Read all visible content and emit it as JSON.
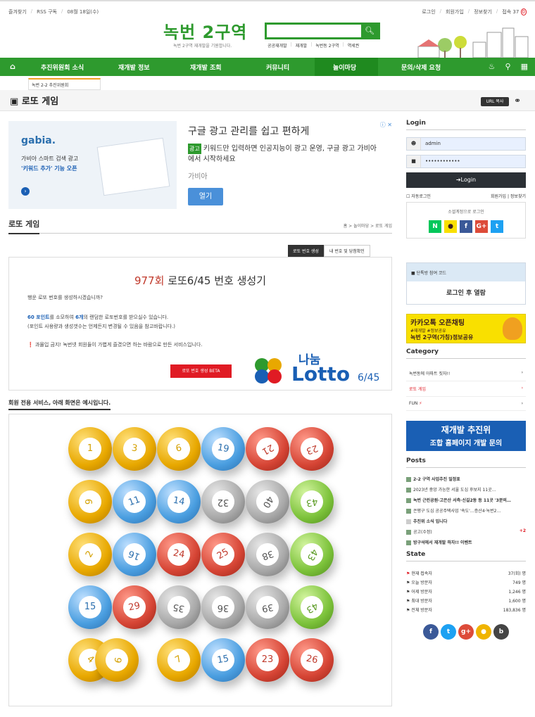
{
  "topbar": {
    "left": [
      "즐겨찾기",
      "RSS 구독",
      "08월 18일(수)"
    ],
    "right": [
      "로그인",
      "회원가입",
      "정보찾기",
      "접속 37"
    ],
    "badge": "0"
  },
  "header": {
    "logo": "녹번 2구역",
    "tagline": "녹번 2구역 재개발을 기원합니다.",
    "quick": [
      "공공재개발",
      "재개발",
      "녹번동 2구역",
      "역세권"
    ]
  },
  "nav": {
    "items": [
      "추진위원회 소식",
      "재개발 정보",
      "재개발 조회",
      "커뮤니티",
      "놀이마당",
      "문의/삭제 요청"
    ],
    "submenu": "녹번 2-2 추진위원회"
  },
  "page": {
    "title": "로또 게임",
    "url_button": "URL 복사"
  },
  "ad": {
    "brand": "gabia.",
    "img_title": "가비아 스마트 검색 광고",
    "img_sub": "'키워드 추가' 기능 오픈",
    "title": "구글 광고 관리를 쉽고 편하게",
    "badge": "광고",
    "text": "키워드만 입력하면 인공지능이 광고 운영, 구글 광고 가비아에서 시작하세요",
    "source": "가비아",
    "button": "열기"
  },
  "section": {
    "title": "로또 게임",
    "breadcrumb": "홈 > 놀이마당 > 로또 게임",
    "tab_active": "로또 번호 생성",
    "tab_other": "내 번호 및 당첨확인"
  },
  "generator": {
    "round": "977회",
    "title": "로또6/45 번호 생성기",
    "q": "행운 로또 번호를 생성하시겠습니까?",
    "points": "60 포인트",
    "points_rest": "를 소모하여 ",
    "count": "6개",
    "count_rest": "의 랜덤한 로또번호를 받으실수 있습니다.",
    "note": "(포인트 사용량과 생성갯수는 언제든지 변경될 수 있음을 참고바랍니다.)",
    "warn": "과몰입 금지! 녹번넷 회원들이 가볍게 즐겼으면 하는 바람으로 만든 서비스입니다.",
    "button": "로또 번호 생성 BETA",
    "logo_top": "나눔",
    "logo_main": "Lotto",
    "logo_sub": "6/45"
  },
  "memo": "회원 전용 서비스, 아래 화면은 예시입니다.",
  "balls": [
    [
      "1",
      "3",
      "6",
      "19",
      "21",
      "23"
    ],
    [
      "9",
      "11",
      "14",
      "32",
      "40",
      "43"
    ],
    [
      "2",
      "16",
      "24",
      "25",
      "38",
      "43"
    ],
    [
      "15",
      "29",
      "35",
      "36",
      "39",
      "43"
    ],
    [
      "4",
      "9",
      "7",
      "15",
      "23",
      "26"
    ]
  ],
  "sidebar": {
    "login_title": "Login",
    "username": "admin",
    "password": "••••••••••••",
    "login_btn": "Login",
    "auto": "자동로그인",
    "join": "회원가입",
    "find": "정보찾기",
    "social_title": "소셜계정으로 로그인",
    "chat_title": "단톡방 참여 코드",
    "chat_body": "로그인 후 열람",
    "kakao_title": "카카오톡 오픈채팅",
    "kakao_sub": "#재개발 #정보공유",
    "kakao_name": "녹번 2구역(가칭)정보공유",
    "category_title": "Category",
    "categories": [
      "녹번동에 아파트 짓자!!",
      "로또 게임",
      "FUN"
    ],
    "promo_title": "재개발 추진위",
    "promo_sub": "조합 홈페이지 개발 문의",
    "posts_title": "Posts",
    "posts": [
      "2-2 구역 사업추진 일정표",
      "2023년 중앙 가능한 서울 도심 후보지 11곳…",
      "녹번 근린공원·고은산 서측·신길2동 등 11곳 '3분의…",
      "은평구 도심 공공주택사업 '속도'…증산4·녹번2…",
      "추진위 소식 입니다",
      "공고(수정)",
      "방구석에서 재개발 하자!! 이벤트"
    ],
    "post_badge": "+2",
    "state_title": "State",
    "states": [
      [
        "현재 접속자",
        "37(회) 명"
      ],
      [
        "오늘 방문자",
        "749 명"
      ],
      [
        "어제 방문자",
        "1,246 명"
      ],
      [
        "최대 방문자",
        "1,600 명"
      ],
      [
        "전체 방문자",
        "183,836 명"
      ]
    ]
  },
  "colors": {
    "brand_green": "#2e9a2e",
    "red": "#e01b24",
    "dark": "#2b3035"
  }
}
